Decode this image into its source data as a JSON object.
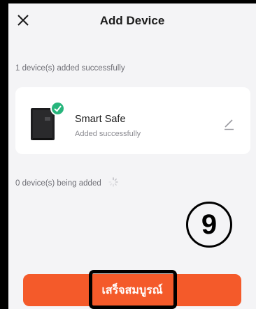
{
  "header": {
    "title": "Add Device"
  },
  "sections": {
    "added_label": "1 device(s) added successfully",
    "adding_label": "0 device(s) being added"
  },
  "device": {
    "name": "Smart Safe",
    "status": "Added successfully"
  },
  "annotation": {
    "step": "9"
  },
  "footer": {
    "done_label": "เสร็จสมบูรณ์"
  },
  "colors": {
    "accent": "#f45a2a",
    "success": "#27b57c",
    "background": "#f4f4f6"
  },
  "icons": {
    "close": "close-icon",
    "check": "check-icon",
    "edit": "pencil-icon",
    "loading": "spinner-icon"
  }
}
